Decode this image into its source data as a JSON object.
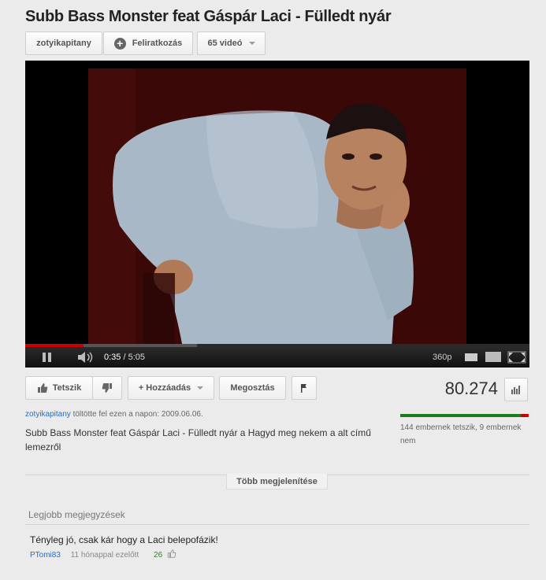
{
  "video": {
    "title": "Subb Bass Monster feat Gáspár Laci - Fülledt nyár"
  },
  "channel": {
    "name": "zotyikapitany",
    "subscribe_label": "Feliratkozás",
    "videos_label": "65 videó"
  },
  "player": {
    "current_time": "0:35",
    "duration": "/ 5:05",
    "quality": "360p",
    "played_fraction": 0.115,
    "loaded_fraction": 0.34
  },
  "actions": {
    "like_label": "Tetszik",
    "add_label": "+ Hozzáadás",
    "share_label": "Megosztás"
  },
  "stats": {
    "views": "80.274",
    "like_fraction": 0.94,
    "ratio_text": "144 embernek tetszik, 9 embernek nem"
  },
  "upload": {
    "user": "zotyikapitany",
    "text": "töltötte fel ezen a napon: 2009.06.06.",
    "description": "Subb Bass Monster feat Gáspár Laci - Fülledt nyár a Hagyd meg nekem a alt című lemezről"
  },
  "more_label": "Több megjelenítése",
  "comments": {
    "heading": "Legjobb megjegyzések",
    "items": [
      {
        "text": "Tényleg jó, csak kár hogy a Laci belepofázik!",
        "author": "PTomi83",
        "age": "11 hónappal ezelőtt",
        "score": "26"
      }
    ]
  },
  "icons": {
    "subscribe": "plus-circle-icon",
    "like": "thumbs-up-icon",
    "dislike": "thumbs-down-icon",
    "flag": "flag-icon",
    "stats": "bar-chart-icon",
    "pause": "pause-icon",
    "volume": "volume-icon",
    "expand": "expand-icon"
  },
  "colors": {
    "link": "#2a6bcc",
    "like_bar": "#1d7b1d",
    "dislike_bar": "#cc0000",
    "progress": "#cc0000"
  }
}
